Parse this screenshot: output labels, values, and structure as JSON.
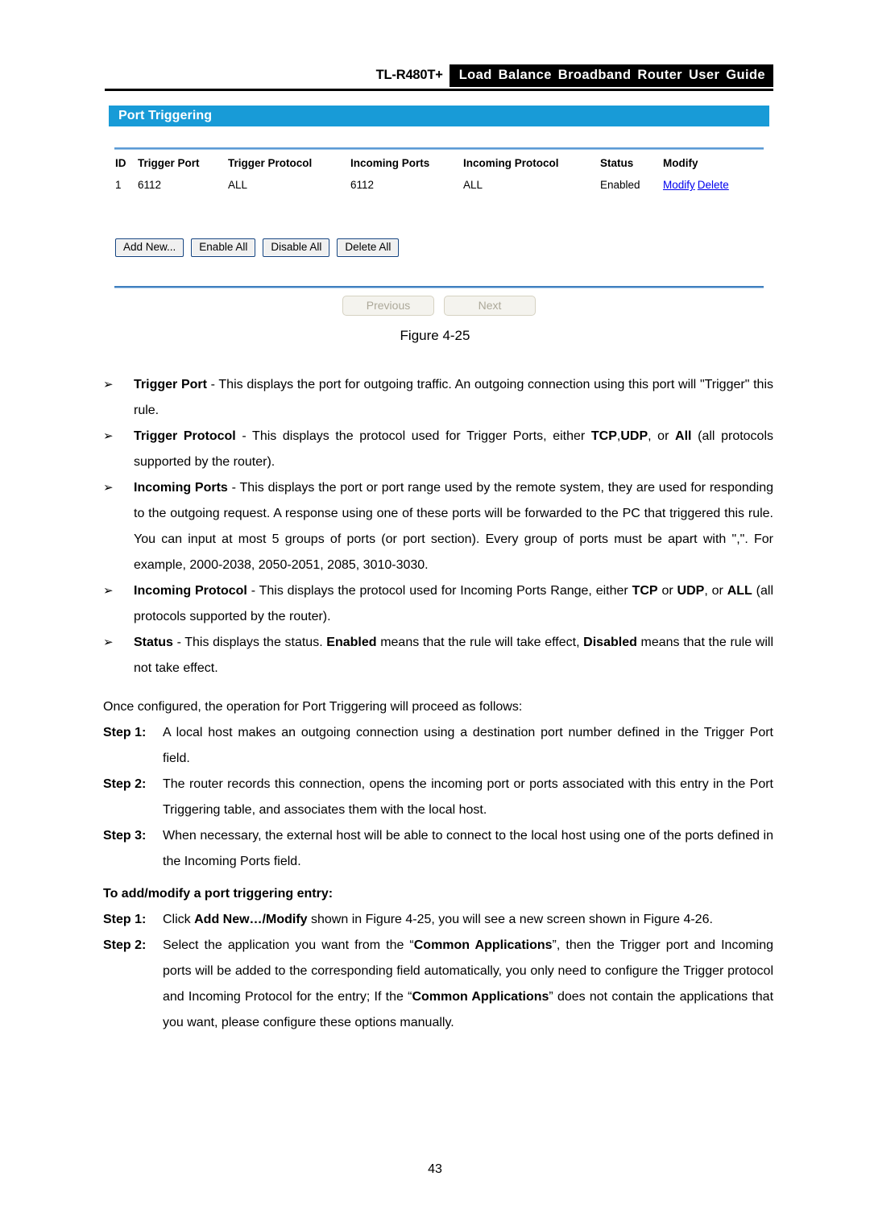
{
  "header": {
    "model": "TL-R480T+",
    "guide_title": "Load Balance Broadband Router User Guide"
  },
  "figure": {
    "panel_title": "Port Triggering",
    "caption": "Figure 4-25",
    "table": {
      "columns": [
        "ID",
        "Trigger Port",
        "Trigger Protocol",
        "Incoming Ports",
        "Incoming Protocol",
        "Status",
        "Modify"
      ],
      "rows": [
        {
          "id": "1",
          "trigger_port": "6112",
          "trigger_protocol": "ALL",
          "incoming_ports": "6112",
          "incoming_protocol": "ALL",
          "status": "Enabled",
          "modify_link": "Modify",
          "delete_link": "Delete"
        }
      ]
    },
    "buttons": {
      "add_new": "Add New...",
      "enable_all": "Enable All",
      "disable_all": "Disable All",
      "delete_all": "Delete All"
    },
    "pager": {
      "previous": "Previous",
      "next": "Next"
    },
    "colors": {
      "panel_header_blue": "#189BD7",
      "separator_blue": "#5B9BD5",
      "link_blue": "#0000EE",
      "button_border": "#12427E",
      "disabled_text": "#ACA899"
    }
  },
  "content": {
    "bullets": [
      {
        "glyph": "➢",
        "term": "Trigger Port",
        "body": " - This displays the port for outgoing traffic. An outgoing connection using this port will \"Trigger\" this rule."
      },
      {
        "glyph": "➢",
        "term": "Trigger Protocol",
        "body_1": " - This displays the protocol used for Trigger Ports, either ",
        "bold_1": "TCP",
        "body_2": ",",
        "bold_2": "UDP",
        "body_3": ", or ",
        "bold_3": "All",
        "body_4": " (all protocols supported by the router)."
      },
      {
        "glyph": "➢",
        "term": "Incoming Ports",
        "body": " - This displays the port or port range used by the remote system, they are used for responding to the outgoing request. A response using one of these ports will be forwarded to the PC that triggered this rule. You can input at most 5 groups of ports (or port section). Every group of ports must be apart with \",\". For example, 2000-2038, 2050-2051, 2085, 3010-3030."
      },
      {
        "glyph": "➢",
        "term": "Incoming Protocol",
        "body_1": " - This displays the protocol used for Incoming Ports Range, either ",
        "bold_1": "TCP",
        "body_2": " or ",
        "bold_2": "UDP",
        "body_3": ", or ",
        "bold_3": "ALL",
        "body_4": " (all protocols supported by the router)."
      },
      {
        "glyph": "➢",
        "term": "Status",
        "body_1": " - This displays the status. ",
        "bold_1": "Enabled",
        "body_2": " means that the rule will take effect, ",
        "bold_2": "Disabled",
        "body_3": " means that the rule will not take effect."
      }
    ],
    "intro_paragraph": "Once configured, the operation for Port Triggering will proceed as follows:",
    "steps_operation": [
      {
        "label": "Step 1:",
        "text": "A local host makes an outgoing connection using a destination port number defined in the Trigger Port field."
      },
      {
        "label": "Step 2:",
        "text": "The router records this connection, opens the incoming port or ports associated with this entry in the Port Triggering table, and associates them with the local host."
      },
      {
        "label": "Step 3:",
        "text": "When necessary, the external host will be able to connect to the local host using one of the ports defined in the Incoming Ports field."
      }
    ],
    "subheading": "To add/modify a port triggering entry:",
    "steps_add": [
      {
        "label": "Step 1:",
        "text_1": "Click ",
        "bold_1": "Add New…/Modify",
        "text_2": " shown in Figure 4-25, you will see a new screen shown in Figure 4-26."
      },
      {
        "label": "Step 2:",
        "text_1": "Select the application you want from the “",
        "bold_1": "Common Applications",
        "text_2": "”, then the Trigger port and Incoming ports will be added to the corresponding field automatically, you only need to configure the Trigger protocol and Incoming Protocol for the entry; If the “",
        "bold_2": "Common Applications",
        "text_3": "” does not contain the applications that you want, please configure these options manually."
      }
    ]
  },
  "footer": {
    "page_number": "43"
  }
}
